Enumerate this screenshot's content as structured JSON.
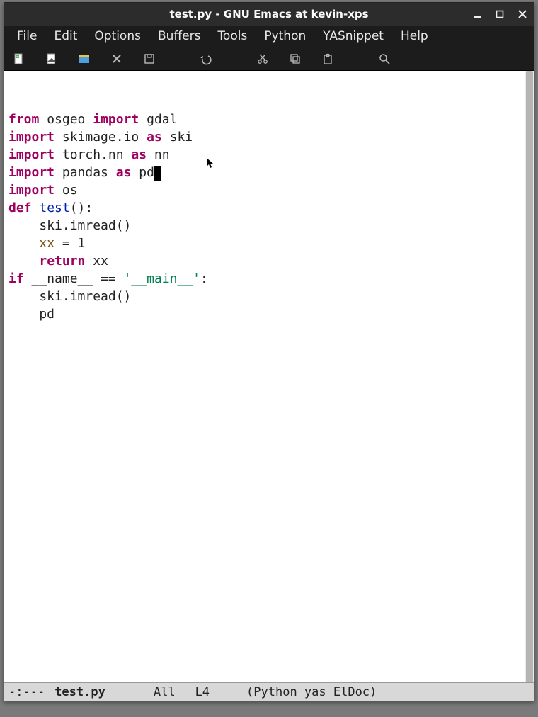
{
  "titlebar": {
    "title": "test.py - GNU Emacs at kevin-xps"
  },
  "menu": {
    "items": [
      "File",
      "Edit",
      "Options",
      "Buffers",
      "Tools",
      "Python",
      "YASnippet",
      "Help"
    ]
  },
  "toolbar": {
    "items": [
      {
        "name": "new-file-icon"
      },
      {
        "name": "open-file-icon"
      },
      {
        "name": "dired-icon"
      },
      {
        "name": "kill-buffer-icon"
      },
      {
        "name": "save-icon"
      },
      {
        "name": "undo-icon"
      },
      {
        "name": "cut-icon"
      },
      {
        "name": "copy-icon"
      },
      {
        "name": "paste-icon"
      },
      {
        "name": "search-icon"
      }
    ]
  },
  "code": {
    "lines": [
      {
        "tokens": [
          [
            "kw",
            "from"
          ],
          [
            "",
            " osgeo "
          ],
          [
            "kw",
            "import"
          ],
          [
            "",
            " gdal"
          ]
        ]
      },
      {
        "tokens": [
          [
            "kw",
            "import"
          ],
          [
            "",
            " skimage.io "
          ],
          [
            "kw",
            "as"
          ],
          [
            "",
            " ski"
          ]
        ]
      },
      {
        "tokens": [
          [
            "kw",
            "import"
          ],
          [
            "",
            " torch.nn "
          ],
          [
            "kw",
            "as"
          ],
          [
            "",
            " nn"
          ]
        ]
      },
      {
        "tokens": [
          [
            "kw",
            "import"
          ],
          [
            "",
            " pandas "
          ],
          [
            "kw",
            "as"
          ],
          [
            "",
            " pd"
          ]
        ],
        "cursor_after": true
      },
      {
        "tokens": [
          [
            "kw",
            "import"
          ],
          [
            "",
            " os"
          ]
        ]
      },
      {
        "tokens": [
          [
            "",
            ""
          ]
        ]
      },
      {
        "tokens": [
          [
            "kw",
            "def"
          ],
          [
            "",
            " "
          ],
          [
            "fn",
            "test"
          ],
          [
            "",
            "():"
          ]
        ]
      },
      {
        "tokens": [
          [
            "",
            "    ski.imread()"
          ]
        ]
      },
      {
        "tokens": [
          [
            "",
            "    "
          ],
          [
            "var",
            "xx"
          ],
          [
            "",
            " = 1"
          ]
        ]
      },
      {
        "tokens": [
          [
            "",
            "    "
          ],
          [
            "kw",
            "return"
          ],
          [
            "",
            " xx"
          ]
        ]
      },
      {
        "tokens": [
          [
            "",
            ""
          ]
        ]
      },
      {
        "tokens": [
          [
            "kw",
            "if"
          ],
          [
            "",
            " __name__ == "
          ],
          [
            "str",
            "'__main__'"
          ],
          [
            "",
            ":"
          ]
        ]
      },
      {
        "tokens": [
          [
            "",
            "    ski.imread()"
          ]
        ]
      },
      {
        "tokens": [
          [
            "",
            "    pd"
          ]
        ]
      }
    ]
  },
  "modeline": {
    "status": "-:---",
    "buffer": "test.py",
    "pos": "All",
    "line": "L4",
    "modes": "(Python yas ElDoc)"
  }
}
